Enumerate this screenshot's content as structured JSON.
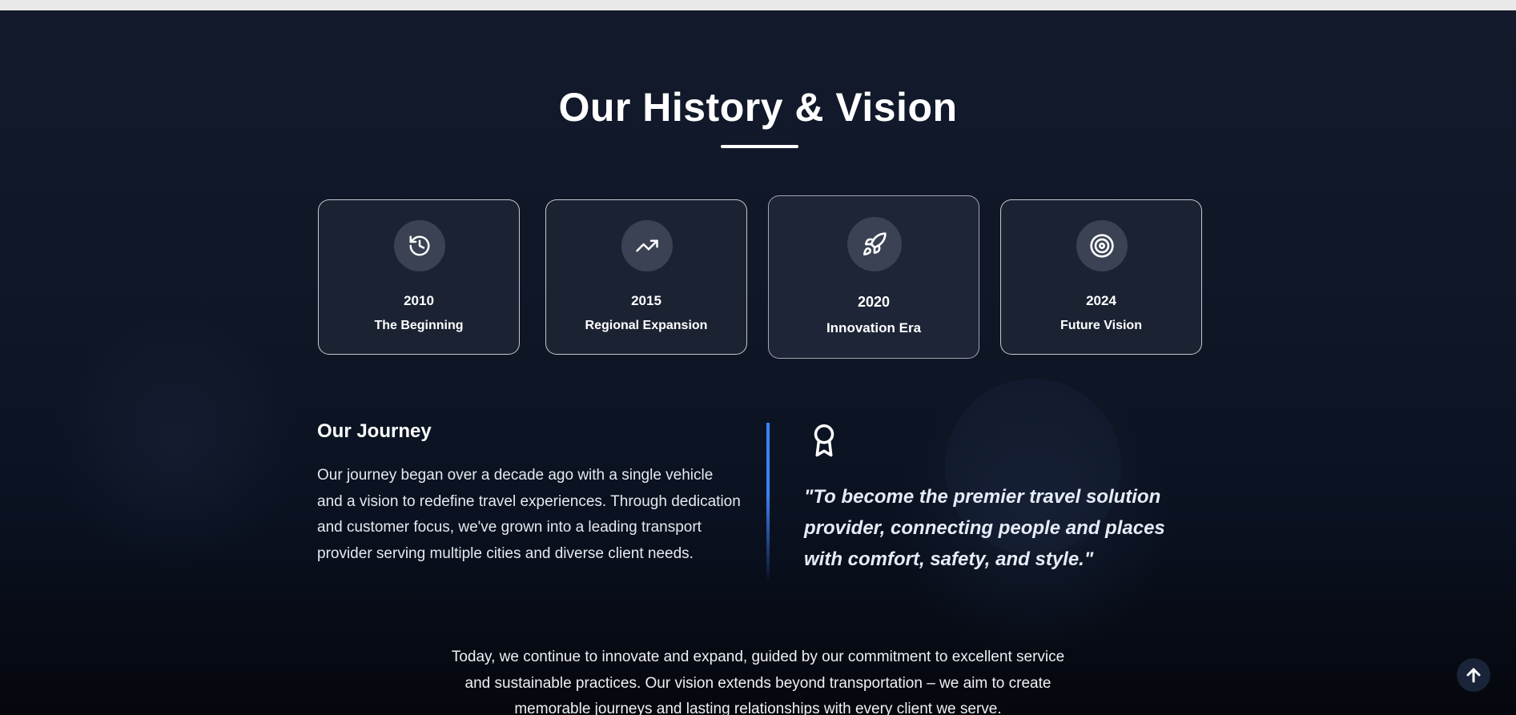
{
  "section": {
    "title": "Our History & Vision"
  },
  "milestones": [
    {
      "year": "2010",
      "label": "The Beginning",
      "icon": "history-icon"
    },
    {
      "year": "2015",
      "label": "Regional Expansion",
      "icon": "trending-up-icon"
    },
    {
      "year": "2020",
      "label": "Innovation Era",
      "icon": "rocket-icon",
      "active": true
    },
    {
      "year": "2024",
      "label": "Future Vision",
      "icon": "target-icon"
    }
  ],
  "journey": {
    "title": "Our Journey",
    "text": "Our journey began over a decade ago with a single vehicle and a vision to redefine travel experiences. Through dedication and customer focus, we've grown into a leading transport provider serving multiple cities and diverse client needs."
  },
  "vision": {
    "icon": "award-icon",
    "quote": "\"To become the premier travel solution provider, connecting people and places with comfort, safety, and style.\""
  },
  "footer": {
    "text": "Today, we continue to innovate and expand, guided by our commitment to excellent service and sustainable practices. Our vision extends beyond transportation – we aim to create memorable journeys and lasting relationships with every client we serve."
  },
  "scroll_top": {
    "icon": "arrow-up-icon"
  },
  "colors": {
    "background": "#0f1727",
    "card": "#1b2333",
    "icon_circle": "#3a4254",
    "accent": "#3b82f6",
    "text": "#ffffff"
  }
}
